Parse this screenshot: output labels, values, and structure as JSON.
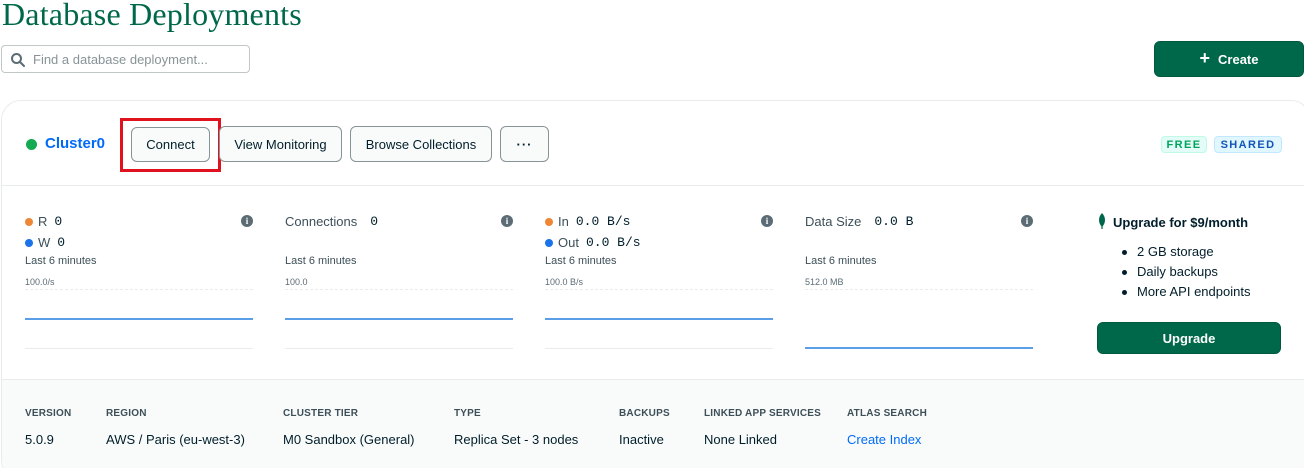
{
  "page": {
    "title": "Database Deployments"
  },
  "search": {
    "placeholder": "Find a database deployment..."
  },
  "actions": {
    "create_label": "Create"
  },
  "cluster": {
    "name": "Cluster0",
    "status_color": "#13aa52",
    "buttons": {
      "connect": "Connect",
      "view_monitoring": "View Monitoring",
      "browse_collections": "Browse Collections",
      "more": "···"
    },
    "badges": {
      "free": "FREE",
      "shared": "SHARED"
    }
  },
  "metrics": [
    {
      "line1_label": "R",
      "line1_value": "0",
      "line2_label": "W",
      "line2_value": "0",
      "period": "Last 6 minutes",
      "scale": "100.0/s"
    },
    {
      "line1_label": "Connections",
      "line1_value": "0",
      "period": "Last 6 minutes",
      "scale": "100.0"
    },
    {
      "line1_label": "In",
      "line1_value": "0.0 B/s",
      "line2_label": "Out",
      "line2_value": "0.0 B/s",
      "period": "Last 6 minutes",
      "scale": "100.0 B/s"
    },
    {
      "line1_label": "Data Size",
      "line1_value": "0.0 B",
      "period": "Last 6 minutes",
      "scale": "512.0 MB"
    }
  ],
  "upgrade": {
    "title": "Upgrade for $9/month",
    "features": [
      "2 GB storage",
      "Daily backups",
      "More API endpoints"
    ],
    "button_label": "Upgrade"
  },
  "details": [
    {
      "label": "VERSION",
      "value": "5.0.9"
    },
    {
      "label": "REGION",
      "value": "AWS / Paris (eu-west-3)"
    },
    {
      "label": "CLUSTER TIER",
      "value": "M0 Sandbox (General)"
    },
    {
      "label": "TYPE",
      "value": "Replica Set - 3 nodes"
    },
    {
      "label": "BACKUPS",
      "value": "Inactive"
    },
    {
      "label": "LINKED APP SERVICES",
      "value": "None Linked"
    },
    {
      "label": "ATLAS SEARCH",
      "value": "Create Index"
    }
  ],
  "colors": {
    "brand_green": "#00684a",
    "link_blue": "#016bf8",
    "highlight_red": "#e0121e"
  }
}
